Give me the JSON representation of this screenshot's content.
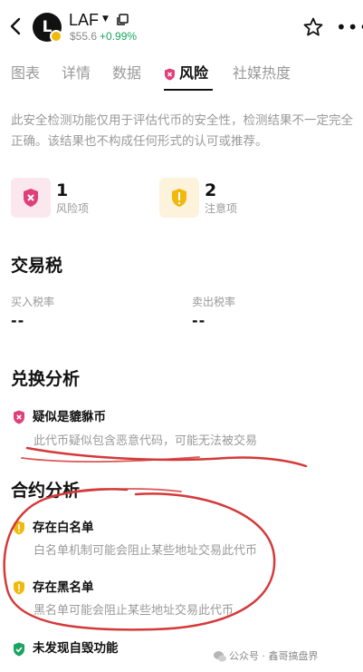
{
  "header": {
    "back_icon": "chevron-left-icon",
    "coin_name": "LAF",
    "avatar_letter": "L",
    "price": "$55.6",
    "change": "+0.99%",
    "change_color": "#1aa361"
  },
  "tabs": [
    {
      "label": "图表"
    },
    {
      "label": "详情"
    },
    {
      "label": "数据"
    },
    {
      "label": "风险",
      "active": true
    },
    {
      "label": "社媒热度"
    }
  ],
  "disclaimer": "此安全检测功能仅用于评估代币的安全性，检测结果不一定完全正确。该结果也不构成任何形式的认可或推荐。",
  "summary": {
    "risk": {
      "count": "1",
      "label": "风险项",
      "color": "#e0407a"
    },
    "notice": {
      "count": "2",
      "label": "注意项",
      "color": "#f0b90b"
    }
  },
  "tax": {
    "title": "交易税",
    "buy_label": "买入税率",
    "buy_value": "--",
    "sell_label": "卖出税率",
    "sell_value": "--"
  },
  "swap": {
    "title": "兑换分析",
    "items": [
      {
        "title": "疑似是貔貅币",
        "desc": "此代币疑似包含恶意代码，可能无法被交易",
        "level": "risk"
      }
    ]
  },
  "contract": {
    "title": "合约分析",
    "items": [
      {
        "title": "存在白名单",
        "desc": "白名单机制可能会阻止某些地址交易此代币",
        "level": "notice"
      },
      {
        "title": "存在黑名单",
        "desc": "黑名单可能会阻止某些地址交易此代币",
        "level": "notice"
      },
      {
        "title": "未发现自毁功能",
        "level": "safe"
      }
    ]
  },
  "watermark": "公众号 · 鑫哥搞盘界",
  "annotation_color": "#d43a3a"
}
